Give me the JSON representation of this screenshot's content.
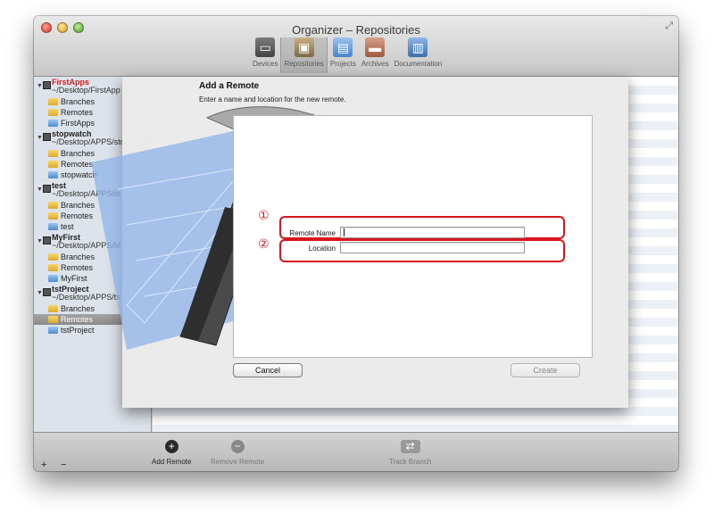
{
  "window": {
    "title": "Organizer – Repositories"
  },
  "toolbar": {
    "items": [
      {
        "label": "Devices",
        "icon": "devices-icon"
      },
      {
        "label": "Repositories",
        "icon": "repositories-icon",
        "active": true
      },
      {
        "label": "Projects",
        "icon": "projects-icon"
      },
      {
        "label": "Archives",
        "icon": "archives-icon"
      },
      {
        "label": "Documentation",
        "icon": "documentation-icon"
      }
    ]
  },
  "sidebar": {
    "repos": [
      {
        "name": "FirstApps",
        "path": "~/Desktop/FirstApp",
        "children": [
          "Branches",
          "Remotes",
          "FirstApps"
        ],
        "name_color": "#d52020"
      },
      {
        "name": "stopwatch",
        "path": "~/Desktop/APPS/sto",
        "children": [
          "Branches",
          "Remotes",
          "stopwatch"
        ]
      },
      {
        "name": "test",
        "path": "~/Desktop/APPS/te",
        "children": [
          "Branches",
          "Remotes",
          "test"
        ]
      },
      {
        "name": "MyFirst",
        "path": "~/Desktop/APPS/M",
        "children": [
          "Branches",
          "Remotes",
          "MyFirst"
        ]
      },
      {
        "name": "tstProject",
        "path": "~/Desktop/APPS/ts",
        "children": [
          "Branches",
          "Remotes",
          "tstProject"
        ],
        "selected_child": "Remotes"
      }
    ],
    "add_label": "+",
    "remove_label": "−"
  },
  "sheet": {
    "title": "Add a Remote",
    "description": "Enter a name and location for the new remote.",
    "remote_name_label": "Remote Name",
    "remote_name_value": "",
    "location_label": "Location",
    "location_value": "",
    "cancel_label": "Cancel",
    "create_label": "Create",
    "annotation_1": "①",
    "annotation_2": "②",
    "annotation_color": "#d9141d"
  },
  "bottombar": {
    "add_remote_label": "Add Remote",
    "remove_remote_label": "Remove Remote",
    "track_branch_label": "Track Branch"
  }
}
